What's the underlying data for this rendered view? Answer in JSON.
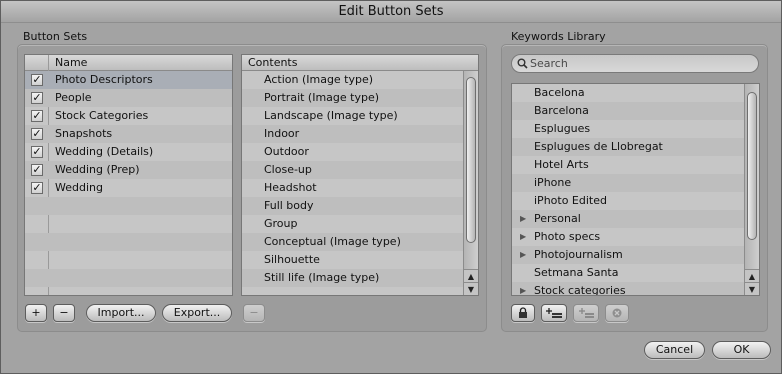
{
  "window": {
    "title": "Edit Button Sets"
  },
  "button_sets": {
    "group_title": "Button Sets",
    "column_header": "Name",
    "items": [
      {
        "label": "Photo Descriptors",
        "checked": "✓"
      },
      {
        "label": "People",
        "checked": "✓"
      },
      {
        "label": "Stock Categories",
        "checked": "✓"
      },
      {
        "label": "Snapshots",
        "checked": "✓"
      },
      {
        "label": "Wedding (Details)",
        "checked": "✓"
      },
      {
        "label": "Wedding (Prep)",
        "checked": "✓"
      },
      {
        "label": "Wedding",
        "checked": "✓"
      }
    ],
    "add_label": "+",
    "remove_label": "−",
    "import_label": "Import...",
    "export_label": "Export..."
  },
  "contents": {
    "column_header": "Contents",
    "items": [
      "Action (Image type)",
      "Portrait (Image type)",
      "Landscape (Image type)",
      "Indoor",
      "Outdoor",
      "Close-up",
      "Headshot",
      "Full body",
      "Group",
      "Conceptual (Image type)",
      "Silhouette",
      "Still life (Image type)"
    ],
    "remove_label": "−"
  },
  "keywords_library": {
    "group_title": "Keywords Library",
    "search_placeholder": "Search",
    "items": [
      {
        "label": "Bacelona",
        "expandable": false
      },
      {
        "label": "Barcelona",
        "expandable": false
      },
      {
        "label": "Esplugues",
        "expandable": false
      },
      {
        "label": "Esplugues de Llobregat",
        "expandable": false
      },
      {
        "label": "Hotel Arts",
        "expandable": false
      },
      {
        "label": "iPhone",
        "expandable": false
      },
      {
        "label": "iPhoto Edited",
        "expandable": false
      },
      {
        "label": "Personal",
        "expandable": true
      },
      {
        "label": "Photo specs",
        "expandable": true
      },
      {
        "label": "Photojournalism",
        "expandable": true
      },
      {
        "label": "Setmana Santa",
        "expandable": false
      },
      {
        "label": "Stock categories",
        "expandable": true
      }
    ]
  },
  "footer": {
    "cancel_label": "Cancel",
    "ok_label": "OK"
  },
  "icons": {
    "search": "magnifier-icon",
    "lock": "lock-icon",
    "add_keyword": "add-keyword-icon",
    "add_child_keyword": "add-child-keyword-icon",
    "delete": "delete-icon",
    "disclosure": "disclosure-triangle-icon"
  }
}
